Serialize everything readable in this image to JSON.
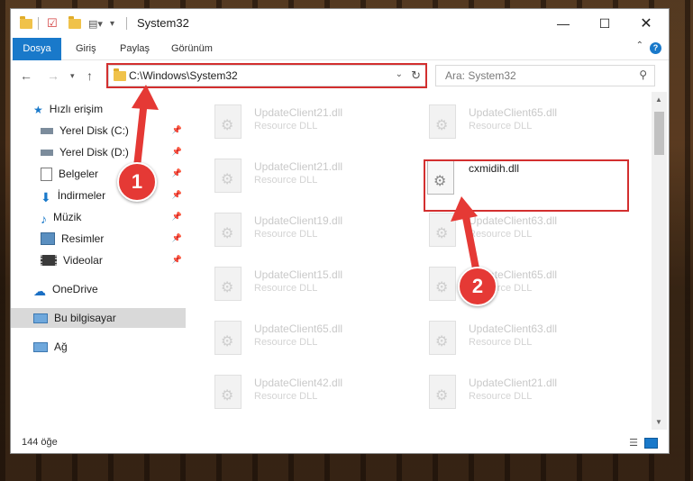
{
  "window": {
    "title": "System32"
  },
  "ribbon": {
    "tabs": [
      "Dosya",
      "Giriş",
      "Paylaş",
      "Görünüm"
    ]
  },
  "address": {
    "path": "C:\\Windows\\System32"
  },
  "search": {
    "placeholder": "Ara: System32"
  },
  "navpane": {
    "quick_access": "Hızlı erişim",
    "items": [
      {
        "label": "Yerel Disk (C:)",
        "icon": "drive-icon"
      },
      {
        "label": "Yerel Disk (D:)",
        "icon": "drive-icon"
      },
      {
        "label": "Belgeler",
        "icon": "documents-icon"
      },
      {
        "label": "İndirmeler",
        "icon": "download-icon"
      },
      {
        "label": "Müzik",
        "icon": "music-icon"
      },
      {
        "label": "Resimler",
        "icon": "pictures-icon"
      },
      {
        "label": "Videolar",
        "icon": "video-icon"
      }
    ],
    "onedrive": "OneDrive",
    "this_pc": "Bu bilgisayar",
    "network": "Ağ"
  },
  "files": {
    "left": [
      {
        "name": "UpdateClient21.dll",
        "type": "Resource DLL"
      },
      {
        "name": "UpdateClient21.dll",
        "type": "Resource DLL"
      },
      {
        "name": "UpdateClient19.dll",
        "type": "Resource DLL"
      },
      {
        "name": "UpdateClient15.dll",
        "type": "Resource DLL"
      },
      {
        "name": "UpdateClient65.dll",
        "type": "Resource DLL"
      },
      {
        "name": "UpdateClient42.dll",
        "type": "Resource DLL"
      }
    ],
    "right": [
      {
        "name": "UpdateClient65.dll",
        "type": "Resource DLL"
      },
      {
        "name": "cxmidih.dll",
        "type": ""
      },
      {
        "name": "UpdateClient63.dll",
        "type": "Resource DLL"
      },
      {
        "name": "UpdateClient65.dll",
        "type": "Resource DLL"
      },
      {
        "name": "UpdateClient63.dll",
        "type": "Resource DLL"
      },
      {
        "name": "UpdateClient21.dll",
        "type": "Resource DLL"
      }
    ]
  },
  "status": {
    "count": "144 öğe"
  },
  "annotations": {
    "step1": "1",
    "step2": "2"
  },
  "colors": {
    "accent": "#1979ca",
    "highlight": "#d32f2f",
    "badge": "#e53935"
  }
}
